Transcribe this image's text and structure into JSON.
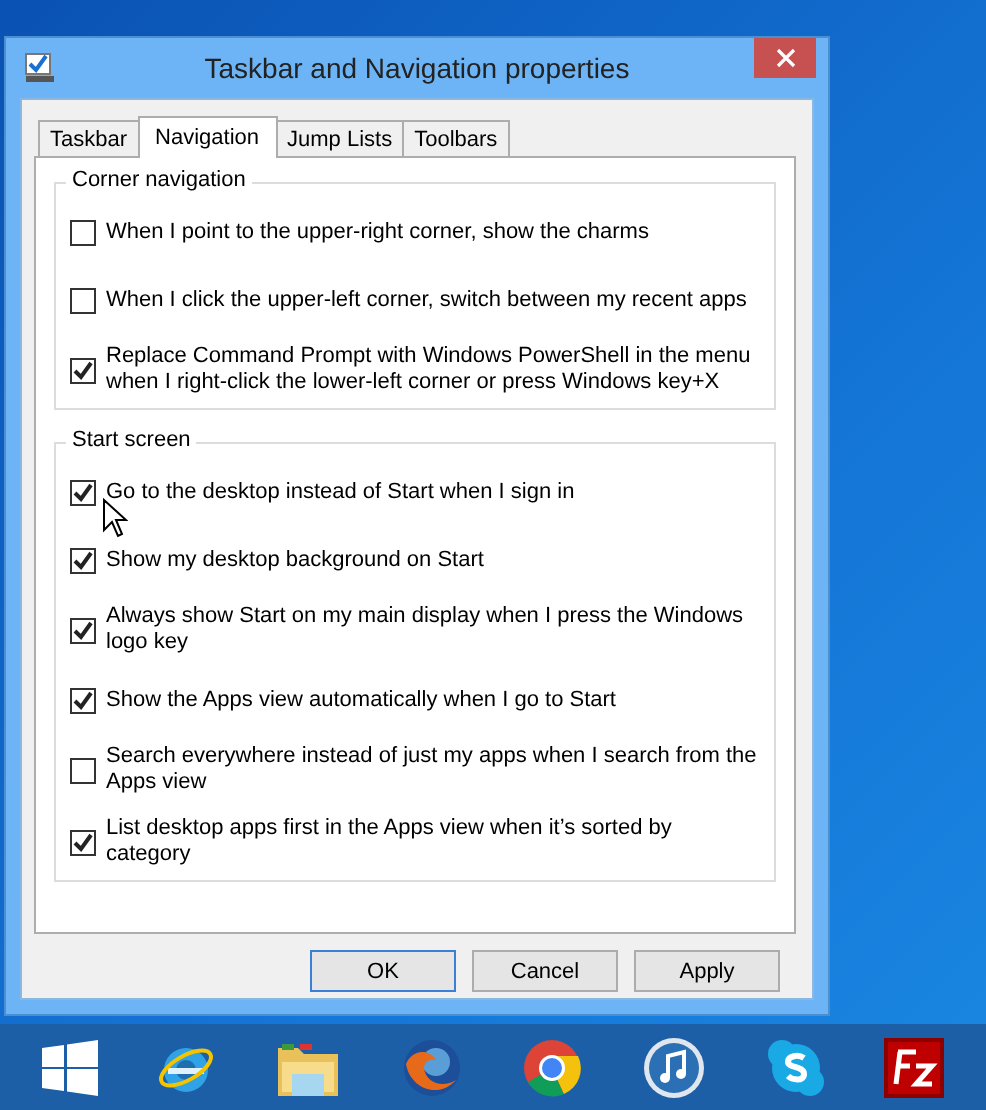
{
  "window": {
    "title": "Taskbar and Navigation properties"
  },
  "tabs": [
    {
      "label": "Taskbar",
      "selected": false
    },
    {
      "label": "Navigation",
      "selected": true
    },
    {
      "label": "Jump Lists",
      "selected": false
    },
    {
      "label": "Toolbars",
      "selected": false
    }
  ],
  "groups": [
    {
      "title": "Corner navigation",
      "options": [
        {
          "label": "When I point to the upper-right corner, show the charms",
          "checked": false
        },
        {
          "label": "When I click the upper-left corner, switch between my recent apps",
          "checked": false
        },
        {
          "label": "Replace Command Prompt with Windows PowerShell in the menu when I right-click the lower-left corner or press Windows key+X",
          "checked": true
        }
      ]
    },
    {
      "title": "Start screen",
      "options": [
        {
          "label": "Go to the desktop instead of Start when I sign in",
          "checked": true
        },
        {
          "label": "Show my desktop background on Start",
          "checked": true
        },
        {
          "label": "Always show Start on my main display when I press the Windows logo key",
          "checked": true
        },
        {
          "label": "Show the Apps view automatically when I go to Start",
          "checked": true
        },
        {
          "label": "Search everywhere instead of just my apps when I search from the Apps view",
          "checked": false
        },
        {
          "label": "List desktop apps first in the Apps view when it’s sorted by category",
          "checked": true
        }
      ]
    }
  ],
  "buttons": [
    {
      "label": "OK",
      "default": true
    },
    {
      "label": "Cancel",
      "default": false
    },
    {
      "label": "Apply",
      "default": false
    }
  ]
}
